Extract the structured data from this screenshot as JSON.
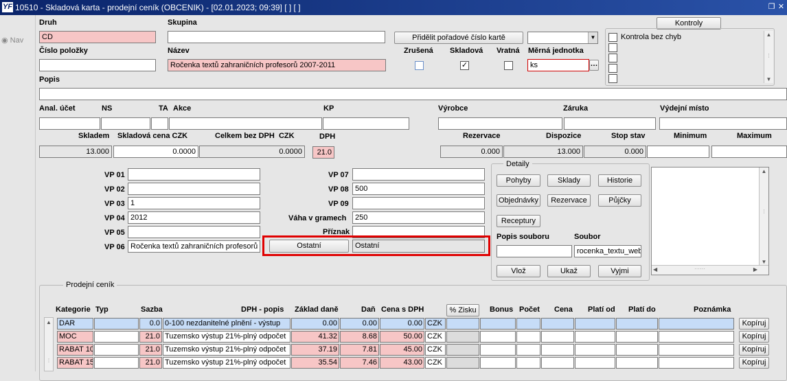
{
  "window": {
    "title": "10510 - Skladová karta - prodejní ceník (OBCENIK) - [02.01.2023; 09:39]  [ ]  [ ]",
    "app_icon_text": "YF"
  },
  "nav": {
    "label": "Nav"
  },
  "header": {
    "druh_label": "Druh",
    "druh_value": "CD",
    "skupina_label": "Skupina",
    "skupina_value": "",
    "assign_button": "Přidělit pořadové číslo kartě",
    "kontroly_button": "Kontroly",
    "kontrola_item": "Kontrola bez chyb",
    "cislo_label": "Číslo položky",
    "cislo_value": "",
    "nazev_label": "Název",
    "nazev_value": "Ročenka textů zahraničních profesorů 2007-2011",
    "zrusena_label": "Zrušená",
    "skladova_label": "Skladová",
    "vratna_label": "Vratná",
    "zrusena_checked": false,
    "skladova_checked": true,
    "vratna_checked": false,
    "mj_label": "Měrná jednotka",
    "mj_value": "ks",
    "popis_label": "Popis",
    "popis_value": ""
  },
  "row2": {
    "anal_label": "Anal. účet",
    "ns_label": "NS",
    "ta_label": "TA",
    "akce_label": "Akce",
    "kp_label": "KP",
    "vyrobce_label": "Výrobce",
    "zaruka_label": "Záruka",
    "vydejni_label": "Výdejní místo"
  },
  "stock": {
    "skladem_label": "Skladem",
    "skladem_value": "13.000",
    "cena_label": "Skladová cena",
    "cena_currency": "CZK",
    "cena_value": "0.0000",
    "celkem_label": "Celkem bez DPH",
    "celkem_currency": "CZK",
    "celkem_value": "0.0000",
    "dph_label": "DPH",
    "dph_value": "21.0",
    "rezervace_label": "Rezervace",
    "rezervace_value": "0.000",
    "dispozice_label": "Dispozice",
    "dispozice_value": "13.000",
    "stop_label": "Stop stav",
    "stop_value": "0.000",
    "minimum_label": "Minimum",
    "minimum_value": "",
    "maximum_label": "Maximum",
    "maximum_value": ""
  },
  "vp": {
    "vp01_label": "VP 01",
    "vp01": "",
    "vp02_label": "VP 02",
    "vp02": "",
    "vp03_label": "VP 03",
    "vp03": "1",
    "vp04_label": "VP 04",
    "vp04": "2012",
    "vp05_label": "VP 05",
    "vp05": "",
    "vp06_label": "VP 06",
    "vp06": "Ročenka textů zahraničních profesorů",
    "vp07_label": "VP 07",
    "vp07": "",
    "vp08_label": "VP 08",
    "vp08": "500",
    "vp09_label": "VP 09",
    "vp09": "",
    "vaha_label": "Váha v gramech",
    "vaha": "250",
    "priznak_label": "Příznak",
    "priznak": "",
    "ostatni_button": "Ostatní",
    "ostatni_value": "Ostatní"
  },
  "detaily": {
    "title": "Detaily",
    "pohyby": "Pohyby",
    "sklady": "Sklady",
    "historie": "Historie",
    "objednavky": "Objednávky",
    "rezervace": "Rezervace",
    "pujcky": "Půjčky",
    "receptury": "Receptury",
    "popis_souboru_label": "Popis souboru",
    "soubor_label": "Soubor",
    "popis_souboru_value": "",
    "soubor_value": "rocenka_textu_web",
    "vloz": "Vlož",
    "ukaz": "Ukaž",
    "vyjmi": "Vyjmi"
  },
  "pricelist": {
    "title": "Prodejní ceník",
    "headers": {
      "kategorie": "Kategorie",
      "typ": "Typ",
      "sazba": "Sazba",
      "dph_popis": "DPH - popis",
      "zaklad": "Základ daně",
      "dan": "Daň",
      "cena_s_dph": "Cena s DPH",
      "zisk": "% Zisku",
      "bonus": "Bonus",
      "pocet": "Počet",
      "cena": "Cena",
      "plati_od": "Platí od",
      "plati_do": "Platí do",
      "poznamka": "Poznámka"
    },
    "rows": [
      {
        "kategorie": "DAR",
        "typ": "",
        "sazba": "0.0",
        "dph": "0-100 nezdanitelné plnění - výstup",
        "zaklad": "0.00",
        "dan": "0.00",
        "cena": "0.00",
        "mena": "CZK",
        "btn": "Kopíruj"
      },
      {
        "kategorie": "MOC",
        "typ": "",
        "sazba": "21.0",
        "dph": "Tuzemsko výstup 21%-plný odpočet",
        "zaklad": "41.32",
        "dan": "8.68",
        "cena": "50.00",
        "mena": "CZK",
        "btn": "Kopíruj"
      },
      {
        "kategorie": "RABAT 10",
        "typ": "",
        "sazba": "21.0",
        "dph": "Tuzemsko výstup 21%-plný odpočet",
        "zaklad": "37.19",
        "dan": "7.81",
        "cena": "45.00",
        "mena": "CZK",
        "btn": "Kopíruj"
      },
      {
        "kategorie": "RABAT 15",
        "typ": "",
        "sazba": "21.0",
        "dph": "Tuzemsko výstup 21%-plný odpočet",
        "zaklad": "35.54",
        "dan": "7.46",
        "cena": "43.00",
        "mena": "CZK",
        "btn": "Kopíruj"
      }
    ]
  },
  "colors": {
    "titlebar": "#0a246a",
    "required": "#f7c6c6",
    "selected": "#c6dcf7",
    "highlight": "#e00000"
  }
}
